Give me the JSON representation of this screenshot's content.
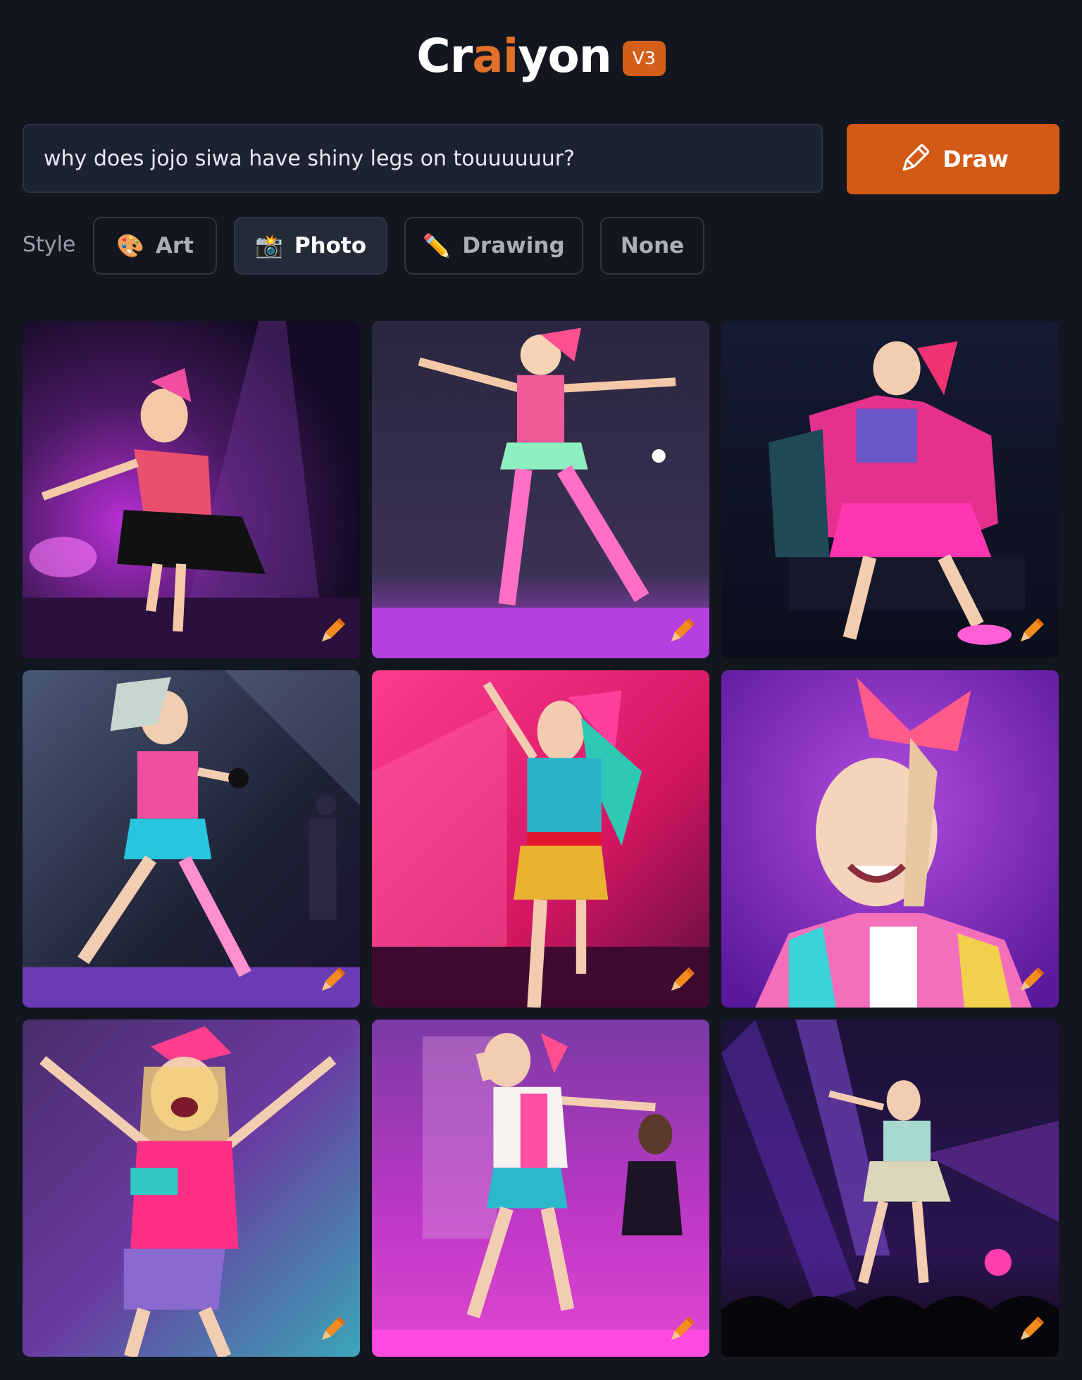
{
  "header": {
    "logo": {
      "part1": "Cr",
      "part2": "ai",
      "part3": "yon"
    },
    "version_badge": "V3"
  },
  "search": {
    "value": "why does jojo siwa have shiny legs on touuuuuur?",
    "draw_label": "Draw"
  },
  "style": {
    "label": "Style",
    "options": [
      {
        "label": "Art",
        "icon": "palette-icon",
        "emoji": "🎨",
        "active": false
      },
      {
        "label": "Photo",
        "icon": "camera-flash-icon",
        "emoji": "📸",
        "active": true
      },
      {
        "label": "Drawing",
        "icon": "pencil-icon",
        "emoji": "✏️",
        "active": false
      },
      {
        "label": "None",
        "icon": "",
        "emoji": "",
        "active": false
      }
    ]
  },
  "results": {
    "count": 9,
    "edit_icon": "pencil-icon"
  },
  "colors": {
    "background": "#12161f",
    "accent": "#d35a14",
    "input_bg": "#1d2230"
  }
}
